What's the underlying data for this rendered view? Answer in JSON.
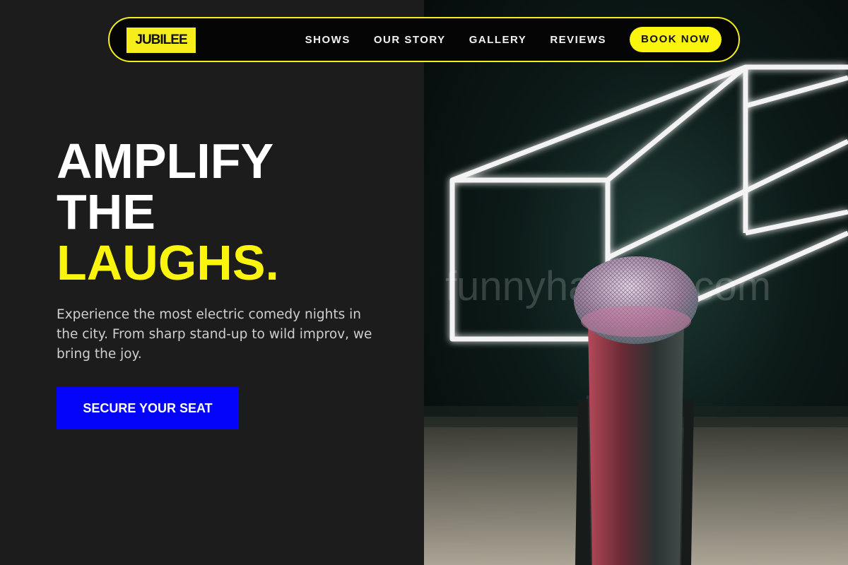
{
  "brand": {
    "logo_text": "JUBILEE",
    "accent_color": "#fbf50e",
    "cta_color": "#0404fb"
  },
  "nav": {
    "links": [
      {
        "label": "SHOWS"
      },
      {
        "label": "OUR STORY"
      },
      {
        "label": "GALLERY"
      },
      {
        "label": "REVIEWS"
      }
    ],
    "book_label": "BOOK NOW"
  },
  "hero": {
    "headline_line1": "AMPLIFY",
    "headline_line2": "THE",
    "headline_accent": "LAUGHS.",
    "lede": "Experience the most electric comedy nights in the city. From sharp stand-up to wild improv, we bring the joy.",
    "cta_label": "SECURE YOUR SEAT",
    "image_description_icon": "microphone-stage-photo"
  }
}
